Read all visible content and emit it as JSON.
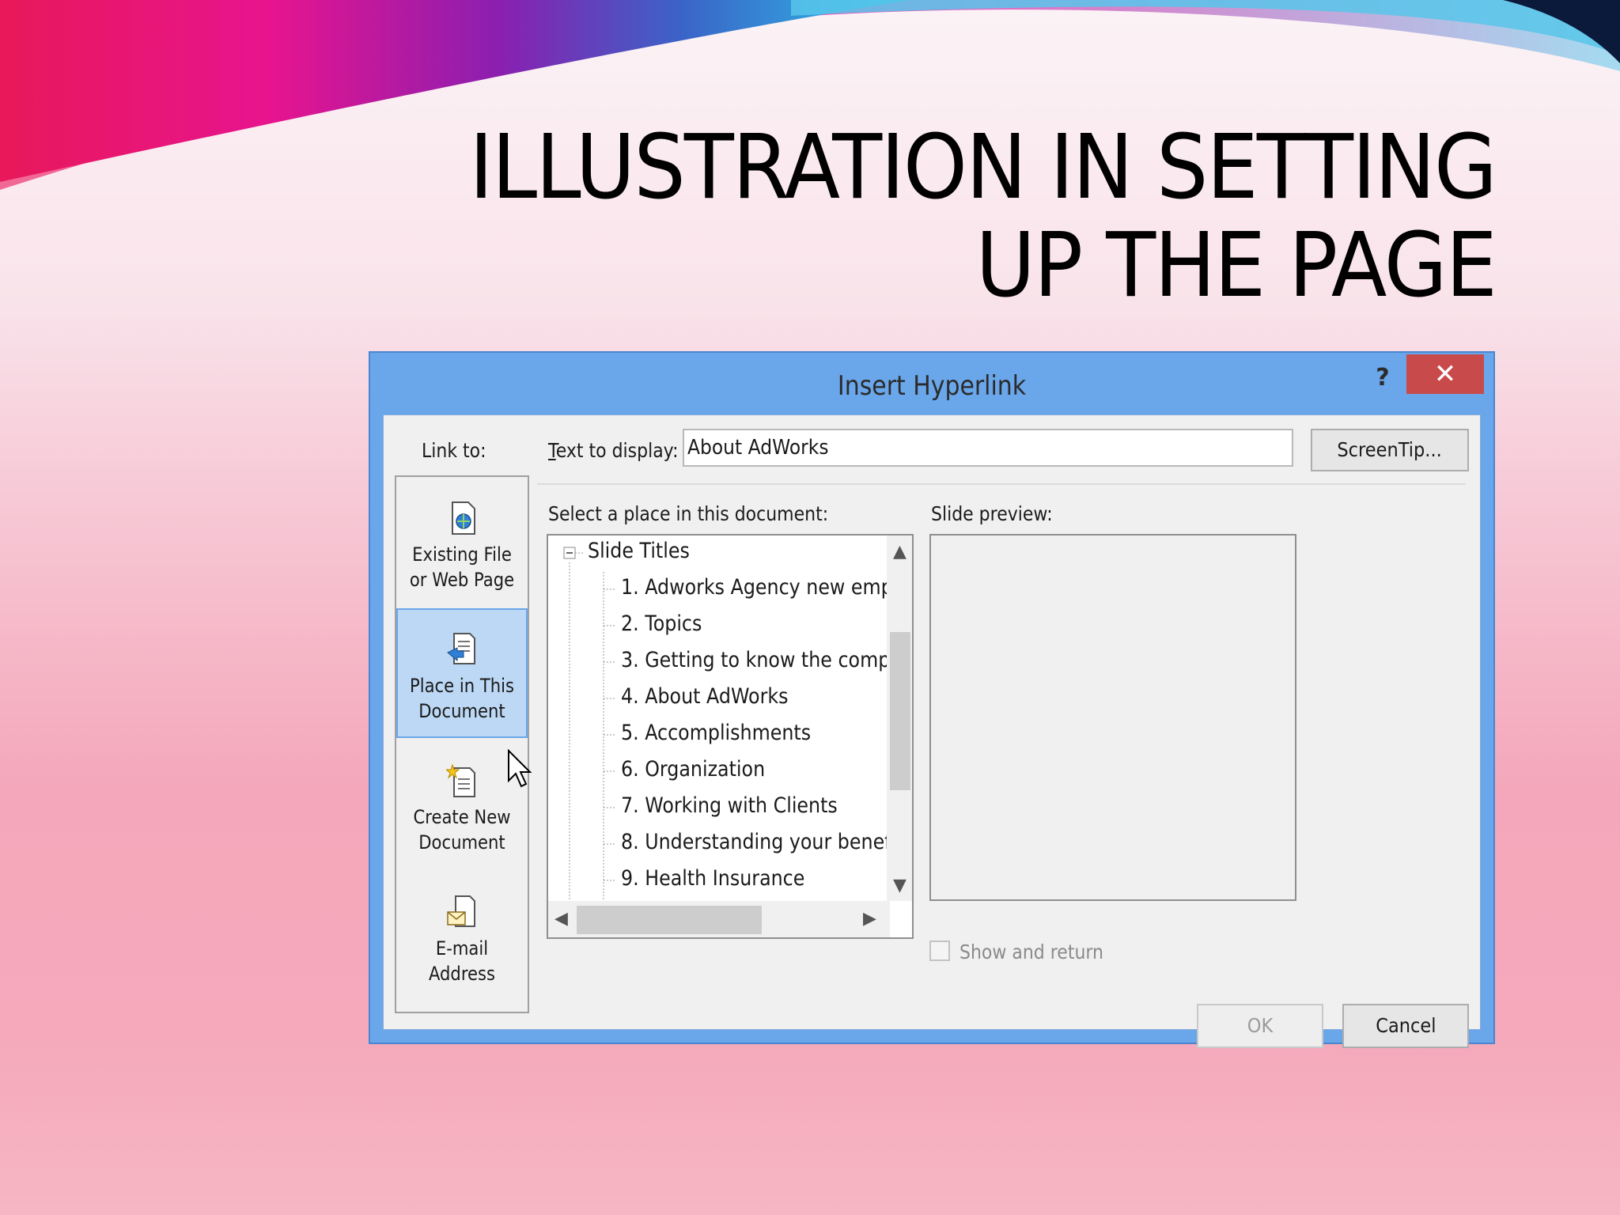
{
  "slide": {
    "title_line1": "ILLUSTRATION IN SETTING",
    "title_line2": "UP THE PAGE"
  },
  "colors": {
    "titlebar": "#6aa6ea",
    "close": "#c94a4a",
    "selected_link": "#bcd8f5"
  },
  "dialog": {
    "title": "Insert Hyperlink",
    "help": "?",
    "close": "✕",
    "link_to_label": "Link to:",
    "text_to_display_label_u": "T",
    "text_to_display_label_rest": "ext to display:",
    "text_to_display_value": "About AdWorks",
    "screentip_button": "ScreenTip...",
    "select_place_label": "Select a place in this document:",
    "slide_preview_label": "Slide preview:",
    "show_and_return": "Show and return",
    "ok_button": "OK",
    "cancel_button": "Cancel",
    "link_items": [
      {
        "line1": "Existing File",
        "line2": "or Web Page",
        "icon": "existing-file-icon"
      },
      {
        "line1": "Place in This",
        "line2": "Document",
        "icon": "place-in-document-icon"
      },
      {
        "line1": "Create New",
        "line2": "Document",
        "icon": "create-new-document-icon"
      },
      {
        "line1": "E-mail",
        "line2": "Address",
        "icon": "email-icon"
      }
    ],
    "tree": {
      "root": "Slide Titles",
      "items": [
        "1. Adworks Agency  new emp",
        "2. Topics",
        "3. Getting to know the comp",
        "4. About AdWorks",
        "5. Accomplishments",
        "6. Organization",
        "7. Working with Clients",
        "8. Understanding your benef",
        "9. Health Insurance"
      ]
    }
  }
}
